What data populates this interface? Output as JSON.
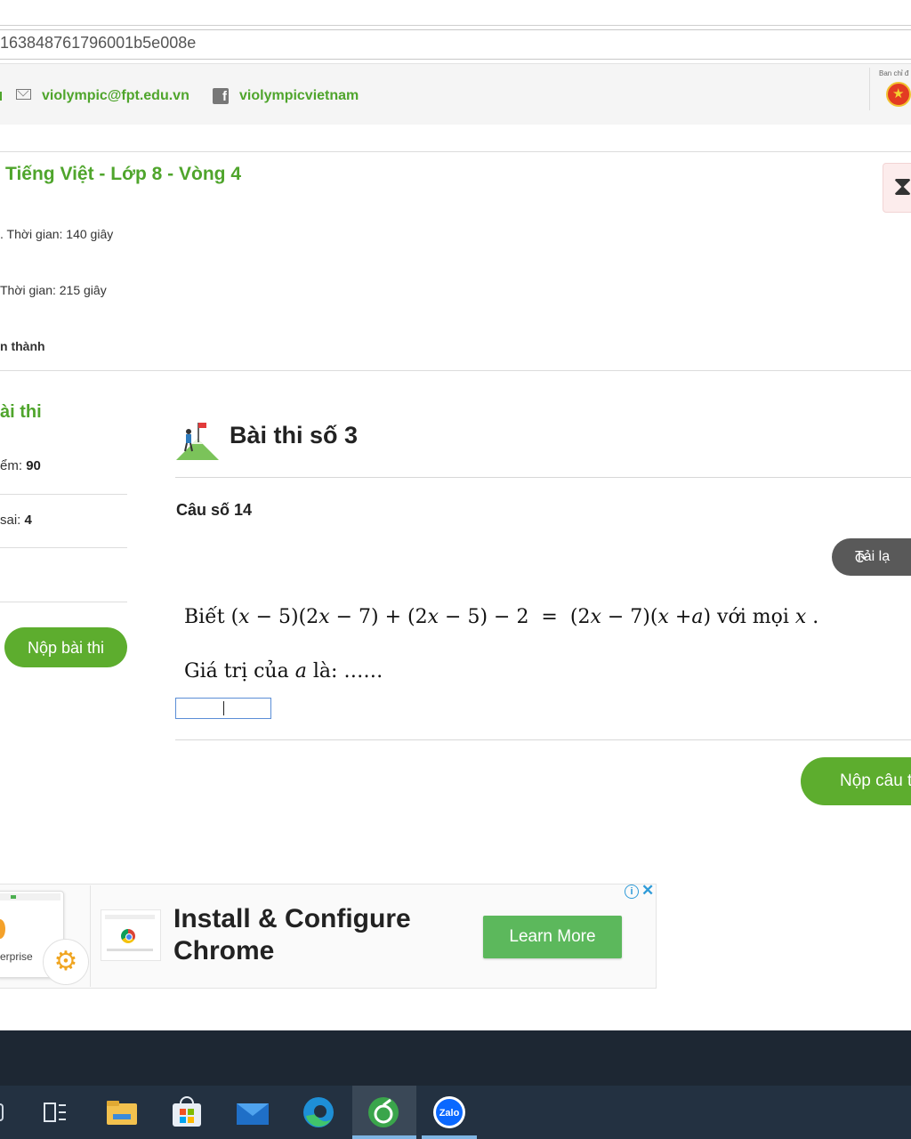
{
  "browser": {
    "url": "163848761796001b5e008e"
  },
  "contact": {
    "email": "violympic@fpt.edu.vn",
    "facebook": "violympicvietnam",
    "emblem_caption": "Ban chỉ đ"
  },
  "exam": {
    "title": "Tiếng Việt - Lớp 8 - Vòng 4",
    "rows": [
      ". Thời gian: 140 giây",
      "Thời gian: 215 giây",
      "n thành"
    ]
  },
  "sidebar": {
    "heading": "ài thi",
    "score_label": "ểm: ",
    "score_value": "90",
    "wrong_label": "sai: ",
    "wrong_value": "4",
    "submit_exam": "Nộp bài thi"
  },
  "test": {
    "title": "Bài thi số 3",
    "question_label": "Câu số 14",
    "reload": "Tải lạ",
    "answer_value": "",
    "submit_answer": "Nộp câu t"
  },
  "question": {
    "line1_prefix": "Biết ",
    "line1_suffix": " với mọi ",
    "line2_prefix": "Giá trị của ",
    "line2_suffix": " là: ……"
  },
  "ad": {
    "thumb_text": "erprise",
    "headline": "Install & Configure Chrome",
    "cta": "Learn More"
  },
  "colors": {
    "accent_green": "#5dad2e",
    "title_green": "#4fa52c",
    "taskbar": "#233141"
  },
  "taskbar": {
    "icons": [
      "task-view-icon",
      "file-explorer-icon",
      "microsoft-store-icon",
      "mail-icon",
      "edge-icon",
      "coccoc-icon",
      "zalo-icon"
    ],
    "zalo_label": "Zalo"
  }
}
